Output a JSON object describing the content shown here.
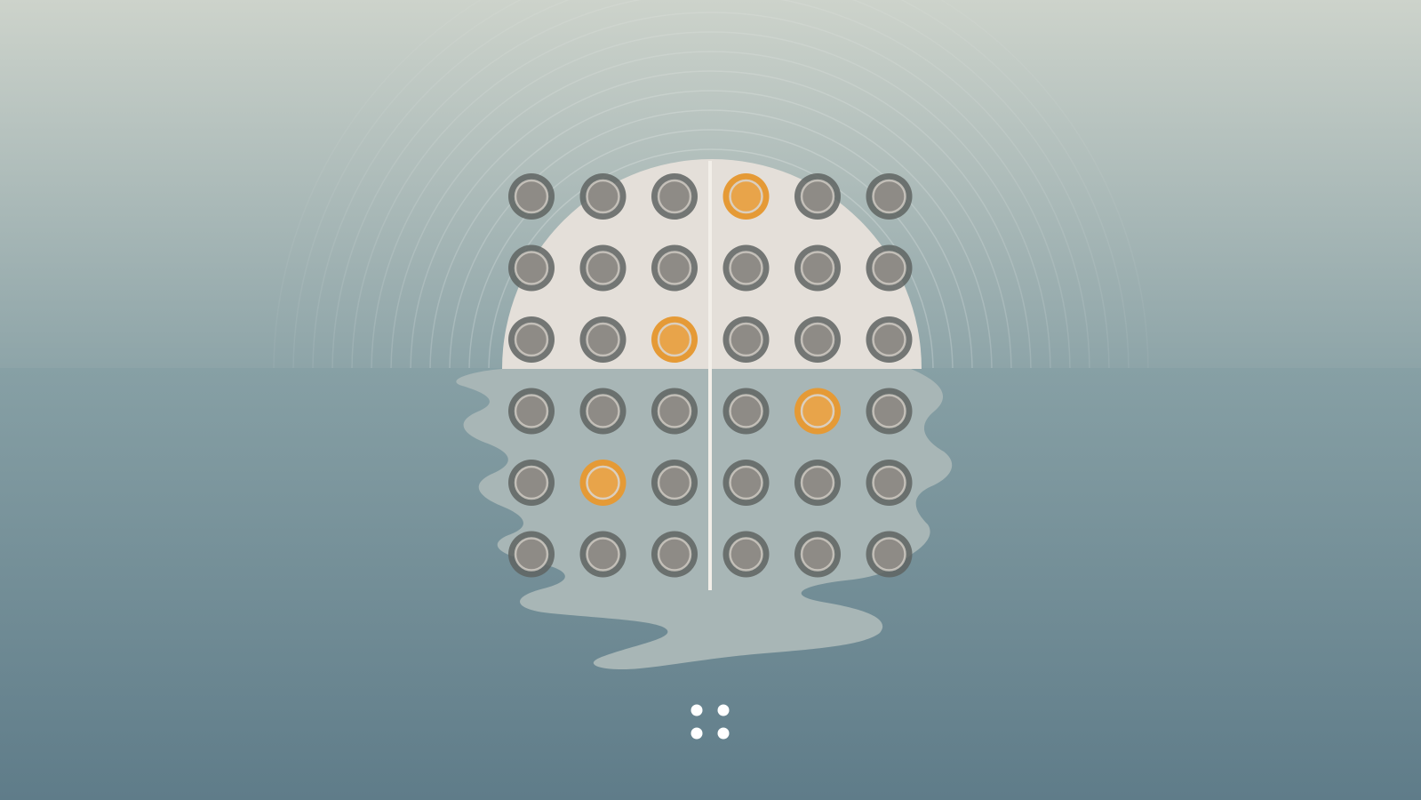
{
  "colors": {
    "sky_top": "#cdd3cb",
    "sky_bottom": "#8da4a8",
    "sea_top": "#87a0a5",
    "sea_bottom": "#5f7c89",
    "sun": "#e4dfd9",
    "reflection": "#a8b6b6",
    "axis": "#f3efe9",
    "peg_off_ring": "#5f6462",
    "peg_off_fill": "#8e8b86",
    "peg_on_ring": "#e59a36",
    "peg_on_fill": "#e8a44a",
    "peg_inner_ring": "#d9d4cc",
    "menu_dots": "#ffffff"
  },
  "board": {
    "rows": 6,
    "cols": 6,
    "cells": [
      [
        0,
        0,
        0,
        1,
        0,
        0
      ],
      [
        0,
        0,
        0,
        0,
        0,
        0
      ],
      [
        0,
        0,
        1,
        0,
        0,
        0
      ],
      [
        0,
        0,
        0,
        0,
        1,
        0
      ],
      [
        0,
        1,
        0,
        0,
        0,
        0
      ],
      [
        0,
        0,
        0,
        0,
        0,
        0
      ]
    ]
  },
  "menu": {
    "icon": "four-dots-menu-icon"
  }
}
